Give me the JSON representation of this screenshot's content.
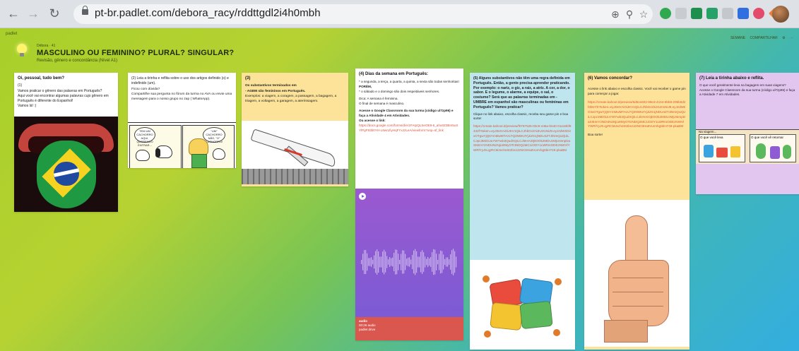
{
  "browser": {
    "url": "pt-br.padlet.com/debora_racy/rddttgdl2i4h0mbh",
    "back_icon": "arrow-left-icon",
    "forward_icon": "arrow-right-icon",
    "reload_icon": "reload-icon"
  },
  "padlet": {
    "brand": "padlet",
    "author": "Débora · 41",
    "title": "MASCULINO OU FEMININO? PLURAL? SINGULAR?",
    "subtitle": "Revisão, gênero e concordância (Nível A1)",
    "actions": [
      "SEMANE",
      "COMPARTILHAR"
    ]
  },
  "cards": [
    {
      "title": "Oi, pessoal, tudo bem?",
      "lines": [
        "(1)",
        "Vamos praticar o gênero das palavras em Português?",
        "Aqui você vai encontrar algumas palavras cujo gênero em Português é diferente do Espanhol!",
        "Vamos lá! :)"
      ],
      "color": "#ffffff"
    },
    {
      "title": "(2) Leia a tirinha e reflita sobre o uso dos artigos definido (o) e indefinido (um).",
      "lines": [
        "Ficou com dúvida?",
        "Compartilhe sua pergunta no fórum da turma no AVA ou envie uma mensagem para o nosso grupo no zap ( WhatsApp)."
      ],
      "comic_bubble_1": "TEM UM CACHORRO AQUI, QUERENDO ENTRAR...",
      "comic_bubble_2": "\"UM\" CACHORRO NÃO, \"O\" CACHORRO!",
      "color": "#ffffff"
    },
    {
      "title": "(3)",
      "lines": [
        "Os substantivos terminados em",
        "- AGEM são femininos em Português.",
        "Exemplos: a viagem, a coragem, a passagem, a bagagem, a triagem, a voltagem, a garagem, a aterrissagem."
      ],
      "color": "#fde39a"
    },
    {
      "title": "(4) Dias da semana em Português:",
      "lines": [
        "* a segunda, a terça, a quarta, a quinta, a sexta são todas senhoritas!",
        "PORÉM,",
        "* o sábado e o domingo são dois respeitáveis senhores.",
        "Dica: A semana é feminina.",
        "O final de semana é masculino.",
        "Acesse o Google Classroom da sua turma (código ul7zp96) e faça a Atividade 4 em Atividades.",
        "Ou acesse o link:"
      ],
      "link": "https://docs.google.com/forms/d/e/1FAIpQLSeOE9-6_aho0Z3Bm5uSYlPgF93b0YH-L8wrLfiyHqFYxJzLeA/viewform?usp=sf_link",
      "audio_title": "audio",
      "audio_meta": "00:26 audio",
      "audio_author": "padlet drive",
      "color": "#ffffff"
    },
    {
      "title": "(5) Alguns substantivos não têm uma regra definida em Português. Então, a gente precisa aprender praticando. Por exemplo: o nariz, o giz, a raiz, a atriz. A cor, a dor, o sabor. E o legume, o alarme, a equipe, o sal, o costume? Será que as palavras terminadas em - UMBRE em espanhol são masculinas ou femininas em Português? Vamos praticar?",
      "lines": [
        "Clique no link abaixo, escolha classic, receba seu game pin e boa sorte!"
      ],
      "link": "https://create.kahoot.it/preview/f0767525-00c9-445a-b540-01e46bf9432f?token=eyJ0eXAiOiJKV1QiLCJhbGciOiJIUzI1NiJ9.eyJzdWIiOiIxOTgwYjQ5YmMwMTAzLTQ3NWUtYjJiZS1jNDU4ZTJiNmQxZjUiLCJpc3MiOiJuYWYwb3QudXQiLCJleHAiOjE0Ok2MDUzMjUsImpDaSI6ImYzNDI4NzNjLWMyOTctNDQ2MC1iODY1LWRmODEzNWVlYWRlYyJ9.qyRCMJvchsSt2bn4J2NC8Ha6VunVkg5bH749-pkaBM",
      "color": "#bfe6ef"
    },
    {
      "title": "(6) Vamos concordar?",
      "lines": [
        "Acesse o link abaixo e escolha classic. Você vai receber o game pin para começar a jogar."
      ],
      "link": "https://create.kahoot.it/preview/6d5ce602-99e3-4104-9bb8-295b0d2f3b57/0?token=eyJ0eXAiOiJKV1QiLCJhbGciOiJIUzI1NiJ9.eyJzdWIiOiIxOTgwYjQ5YmMwMTAzLTQ3NWUtYjJiZS1jNDU4ZTJiNmQxZjUiLCJpc3MiOiJuYWYwb3QudXQiLCJleHAiOjE0Ok2MDUzMjUsImpDaSI6ImYzNDI4NzNjLWMyOTctNDQ2MC1iODY1LWRmODEzNWVlYWRlYyJ9.qyRCMJvchsSt2bn4J2NC8Ha6VunVkg5bH749-pkaBM",
      "closing": "Boa sorte!",
      "color": "#fde39a"
    },
    {
      "title": "(7) Leia a tirinha abaixo e reflita.",
      "lines": [
        "O que você geralmente leva na bagagem em suas viagens?",
        "Acesse o Google Classroom da sua turma (código ul7zp96) e faça a Atividade 7 em Atividades."
      ],
      "comic_caption": "Na viagem...",
      "comic_left": "O que você leva",
      "comic_right": "O que você vê retornar",
      "color": "#e3c6f0"
    }
  ],
  "colors": {
    "accent_link": "#e0533b",
    "audio": "#7c5bd4",
    "audio_footer": "#d9574f"
  }
}
